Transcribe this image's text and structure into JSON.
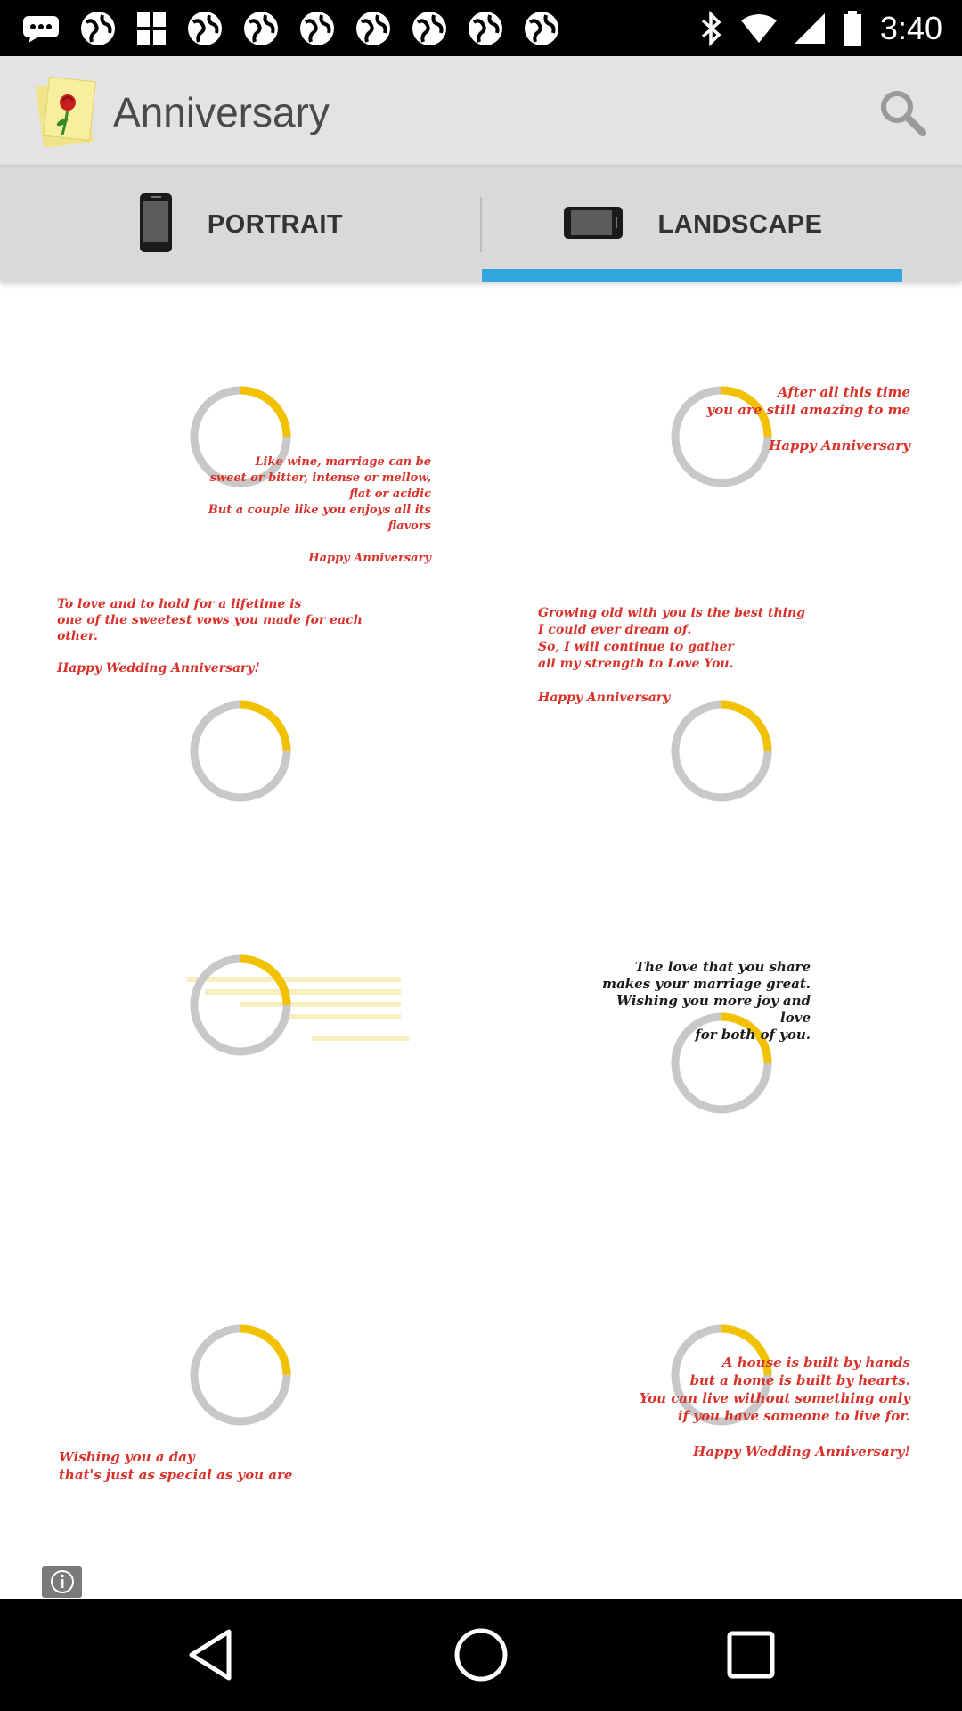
{
  "status_bar": {
    "time": "3:40",
    "notification_icons": [
      "globe-icon",
      "globe-icon",
      "grid-icon",
      "globe-icon",
      "globe-icon",
      "globe-icon",
      "globe-icon",
      "globe-icon",
      "globe-icon",
      "globe-icon"
    ]
  },
  "app_bar": {
    "title": "Anniversary",
    "logo_icon": "rose-card-icon",
    "search_icon": "search-icon"
  },
  "tabs": [
    {
      "label": "PORTRAIT",
      "icon": "phone-portrait-icon",
      "selected": false
    },
    {
      "label": "LANDSCAPE",
      "icon": "phone-landscape-icon",
      "selected": true
    }
  ],
  "colors": {
    "accent": "#33a6df",
    "greeting_text": "#d8322a",
    "spinner_track": "#c8c8c8",
    "spinner_arc": "#f2c200"
  },
  "cards": [
    {
      "text": "Like wine, marriage can be\nsweet or bitter, intense or mellow, flat or acidic\nBut a couple like you enjoys all its flavors\n\nHappy Anniversary",
      "faded": false
    },
    {
      "text": "After all this time\nyou are still amazing to me\n\nHappy Anniversary",
      "faded": false
    },
    {
      "text": "To love and to hold for a lifetime is\none of the sweetest vows you made for each other.\n\nHappy Wedding Anniversary!",
      "faded": false
    },
    {
      "text": "Growing old with you is the best thing\nI could ever dream of.\nSo, I will continue to gather\nall my strength to Love You.\n\nHappy Anniversary",
      "faded": false
    },
    {
      "text": "",
      "faded": true
    },
    {
      "text": "The love that you share\nmakes your marriage great.\nWishing you more joy and love\nfor both of you.",
      "faded": false
    },
    {
      "text": "Wishing you a day\nthat's just as special as you are",
      "faded": false
    },
    {
      "text": "A house is built by hands\nbut a home is built by hearts.\nYou can live without something only\nif you have someone to live for.\n\nHappy Wedding Anniversary!",
      "faded": false
    }
  ],
  "info_icon": "info-icon",
  "nav_bar": {
    "back_icon": "back-triangle-icon",
    "home_icon": "home-circle-icon",
    "recents_icon": "recents-square-icon"
  }
}
